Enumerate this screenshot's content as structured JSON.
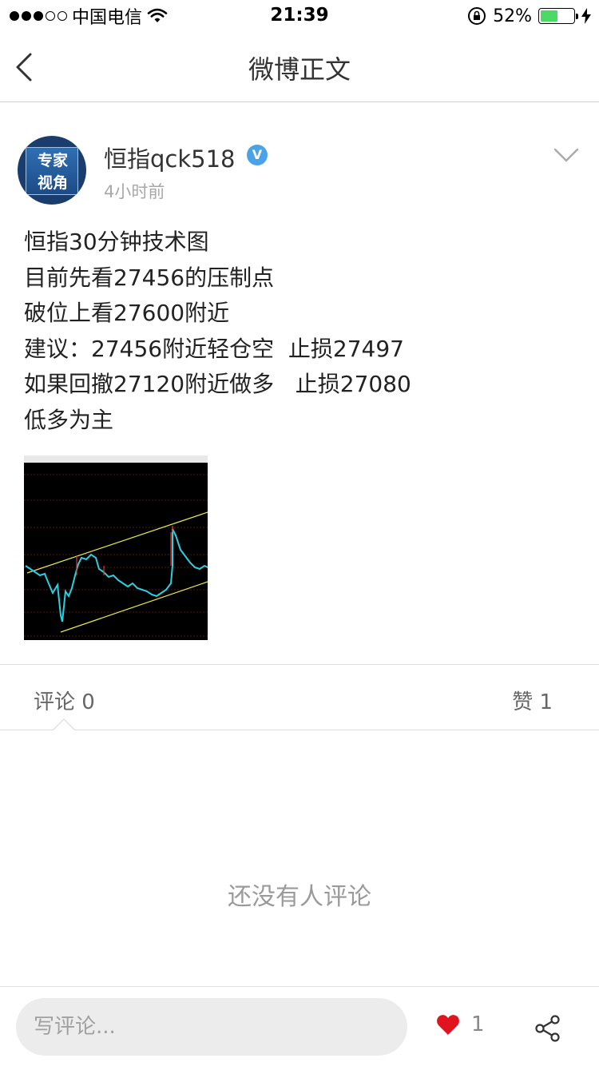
{
  "status_bar": {
    "carrier": "中国电信",
    "time": "21:39",
    "battery_percent": "52%",
    "battery_level": 0.52,
    "signal_bars": 3
  },
  "nav": {
    "title": "微博正文",
    "back_icon": "chevron-left-icon"
  },
  "post": {
    "avatar_lines": [
      "专家",
      "视角"
    ],
    "username": "恒指qck518",
    "verified_badge": "V",
    "time": "4小时前",
    "lines": [
      "恒指30分钟技术图",
      "目前先看27456的压制点",
      "破位上看27600附近",
      "建议：27456附近轻仓空  止损27497",
      "如果回撤27120附近做多   止损27080",
      "低多为主"
    ]
  },
  "tabs": {
    "comments": "评论 0",
    "likes": "赞 1"
  },
  "empty_state": "还没有人评论",
  "bottom_bar": {
    "comment_placeholder": "写评论...",
    "like_count": "1"
  },
  "colors": {
    "accent_blue": "#4aa3e8",
    "heart_red": "#e0141e",
    "battery_green": "#4cd964"
  }
}
